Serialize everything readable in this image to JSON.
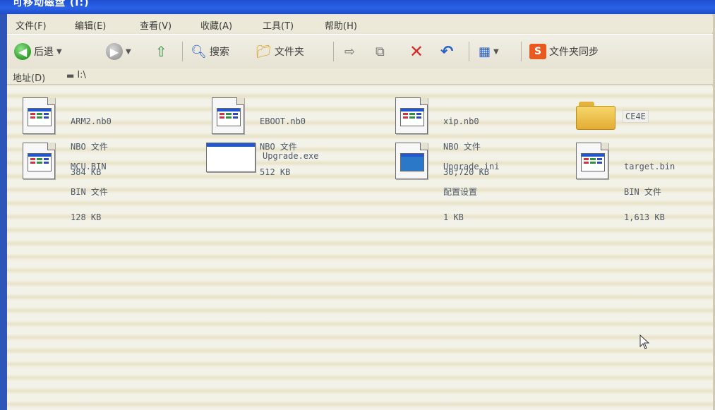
{
  "window": {
    "title": "可移动磁盘 (I:)"
  },
  "menu": [
    {
      "label": "文件(F)"
    },
    {
      "label": "编辑(E)"
    },
    {
      "label": "查看(V)"
    },
    {
      "label": "收藏(A)"
    },
    {
      "label": "工具(T)"
    },
    {
      "label": "帮助(H)"
    }
  ],
  "toolbar": {
    "back_label": "后退",
    "search_label": "搜索",
    "folders_label": "文件夹",
    "sync_label": "文件夹同步"
  },
  "address": {
    "label": "地址(D)",
    "path": "I:\\"
  },
  "files": [
    {
      "name": "ARM2.nb0",
      "type": "NBO 文件",
      "size": "384 KB",
      "icon": "nb0-file-icon"
    },
    {
      "name": "EBOOT.nb0",
      "type": "NBO 文件",
      "size": "512 KB",
      "icon": "nb0-file-icon"
    },
    {
      "name": "xip.nb0",
      "type": "NBO 文件",
      "size": "30,720 KB",
      "icon": "nb0-file-icon"
    },
    {
      "name": "CE4E",
      "type": "",
      "size": "",
      "icon": "folder-icon"
    },
    {
      "name": "MCU.BIN",
      "type": "BIN 文件",
      "size": "128 KB",
      "icon": "bin-file-icon"
    },
    {
      "name": "Upgrade.exe",
      "type": "",
      "size": "",
      "icon": "exe-file-icon"
    },
    {
      "name": "Upgrade.ini",
      "type": "配置设置",
      "size": "1 KB",
      "icon": "ini-file-icon"
    },
    {
      "name": "target.bin",
      "type": "BIN 文件",
      "size": "1,613 KB",
      "icon": "bin-file-icon"
    }
  ],
  "colors": {
    "titlebar": "#2a62e8",
    "toolbar_bg": "#ece9d8",
    "file_text": "#4d5868"
  }
}
